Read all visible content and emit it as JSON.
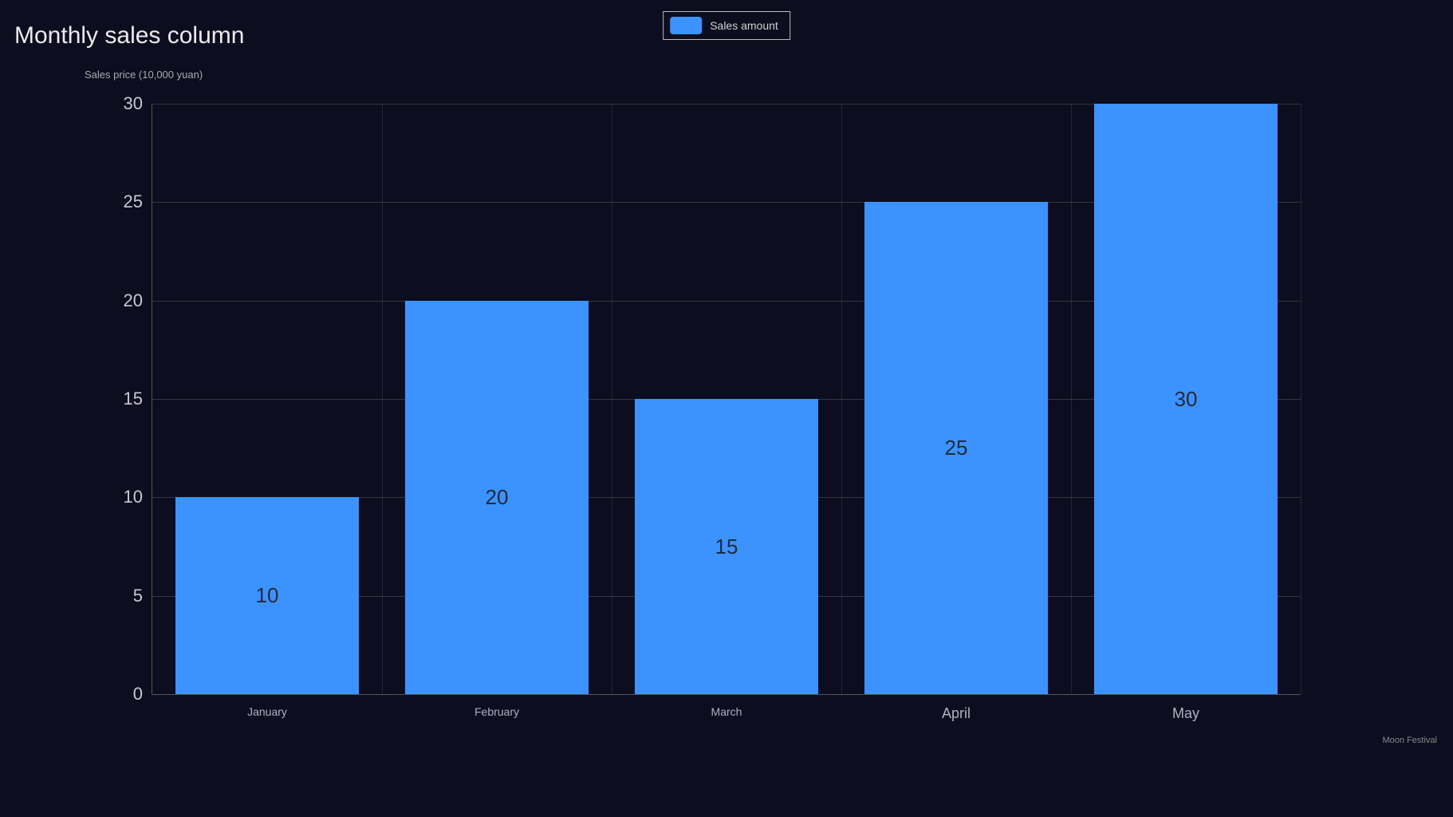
{
  "chart_data": {
    "type": "bar",
    "title": "Monthly sales column",
    "legend_label": "Sales amount",
    "xlabel": "Moon Festival",
    "ylabel": "Sales price (10,000 yuan)",
    "ylim": [
      0,
      30
    ],
    "yticks": [
      0,
      5,
      10,
      15,
      20,
      25,
      30
    ],
    "categories": [
      "January",
      "February",
      "March",
      "April",
      "May"
    ],
    "values": [
      10,
      20,
      15,
      25,
      30
    ],
    "bar_color": "#3c92ff"
  }
}
